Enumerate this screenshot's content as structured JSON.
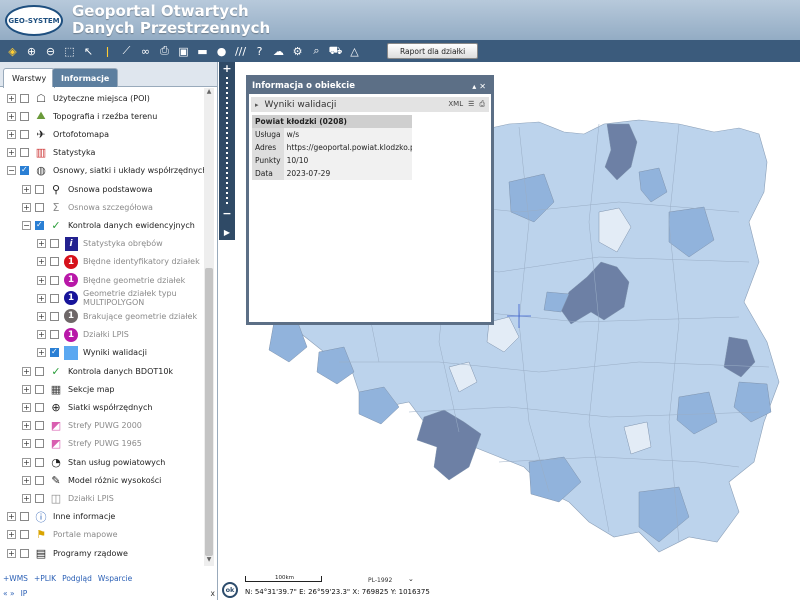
{
  "header": {
    "logo_text": "GEO-SYSTEM",
    "title_line1": "Geoportal Otwartych",
    "title_line2": "Danych Przestrzennych"
  },
  "toolbar": {
    "icons": [
      "layers-icon",
      "zoom-in-icon",
      "zoom-out-icon",
      "full-extent-icon",
      "pointer-icon",
      "identify-icon",
      "measure-icon",
      "link-icon",
      "print-icon",
      "export-icon",
      "draw-line-icon",
      "comment-icon",
      "hatch-icon",
      "help-icon",
      "cloud-icon",
      "settings-icon",
      "search-icon",
      "cart-icon",
      "shapes-icon"
    ],
    "report_button": "Raport dla działki"
  },
  "left_panel": {
    "tabs": [
      {
        "label": "Warstwy",
        "active": true
      },
      {
        "label": "Informacje",
        "active": false
      }
    ],
    "layers": [
      {
        "label": "Użyteczne miejsca (POI)",
        "icon": "poi-icon",
        "checked": false,
        "level": 0
      },
      {
        "label": "Topografia i rzeźba terenu",
        "icon": "topography-icon",
        "checked": false,
        "level": 0
      },
      {
        "label": "Ortofotomapa",
        "icon": "satellite-icon",
        "checked": false,
        "level": 0
      },
      {
        "label": "Statystyka",
        "icon": "chart-icon",
        "checked": false,
        "level": 0
      },
      {
        "label": "Osnowy, siatki i układy współrzędnych",
        "icon": "globe-icon",
        "checked": true,
        "level": 0
      },
      {
        "label": "Osnowa podstawowa",
        "icon": "pin-icon",
        "checked": false,
        "level": 1
      },
      {
        "label": "Osnowa szczegółowa",
        "icon": "sigma-icon",
        "checked": false,
        "level": 1,
        "dim": true
      },
      {
        "label": "Kontrola danych ewidencyjnych",
        "icon": "check-circle-icon",
        "checked": true,
        "level": 1
      },
      {
        "label": "Statystyka obrębów",
        "icon": "info-box-icon",
        "checked": false,
        "level": 2,
        "dim": true
      },
      {
        "label": "Błędne identyfikatory działek",
        "icon": "badge-red-1",
        "checked": false,
        "level": 2,
        "dim": true
      },
      {
        "label": "Błędne geometrie działek",
        "icon": "badge-magenta-1",
        "checked": false,
        "level": 2,
        "dim": true
      },
      {
        "label": "Geometrie działek typu MULTIPOLYGON",
        "icon": "badge-navy-1",
        "checked": false,
        "level": 2,
        "dim": true
      },
      {
        "label": "Brakujące geometrie działek",
        "icon": "badge-gray-1",
        "checked": false,
        "level": 2,
        "dim": true
      },
      {
        "label": "Działki LPIS",
        "icon": "badge-magenta-1",
        "checked": false,
        "level": 2,
        "dim": true
      },
      {
        "label": "Wyniki walidacji",
        "icon": "blue-square-icon",
        "checked": true,
        "level": 2
      },
      {
        "label": "Kontrola danych BDOT10k",
        "icon": "check-circle-icon",
        "checked": false,
        "level": 1
      },
      {
        "label": "Sekcje map",
        "icon": "grid-icon",
        "checked": false,
        "level": 1
      },
      {
        "label": "Siatki współrzędnych",
        "icon": "globe-grid-icon",
        "checked": false,
        "level": 1
      },
      {
        "label": "Strefy PUWG 2000",
        "icon": "zones-icon",
        "checked": false,
        "level": 1,
        "dim": true
      },
      {
        "label": "Strefy PUWG 1965",
        "icon": "zones-icon",
        "checked": false,
        "level": 1,
        "dim": true
      },
      {
        "label": "Stan usług powiatowych",
        "icon": "status-icon",
        "checked": false,
        "level": 1
      },
      {
        "label": "Model różnic wysokości",
        "icon": "height-model-icon",
        "checked": false,
        "level": 1
      },
      {
        "label": "Działki LPIS",
        "icon": "lpis-icon",
        "checked": false,
        "level": 1,
        "dim": true
      },
      {
        "label": "Inne informacje",
        "icon": "info-icon",
        "checked": false,
        "level": 0
      },
      {
        "label": "Portale mapowe",
        "icon": "portal-icon",
        "checked": false,
        "level": 0,
        "dim": true
      },
      {
        "label": "Programy rządowe",
        "icon": "map-icon",
        "checked": false,
        "level": 0
      }
    ],
    "links": [
      "+WMS",
      "+PLIK",
      "Podgląd",
      "Wsparcie"
    ],
    "footer": {
      "left": "«  »",
      "ip": "IP",
      "close": "x"
    }
  },
  "info_dialog": {
    "title": "Informacja o obiekcie",
    "section": "Wyniki walidacji",
    "xml_label": "XML",
    "table_header": "Powiat kłodzki (0208)",
    "rows": [
      {
        "key": "Usługa",
        "value": "w/s"
      },
      {
        "key": "Adres",
        "value": "https://geoportal.powiat.klodzko.pl/gsp"
      },
      {
        "key": "Punkty",
        "value": "10/10"
      },
      {
        "key": "Data",
        "value": "2023-07-29"
      }
    ]
  },
  "map": {
    "ok_button": "ok",
    "scale_label": "100km",
    "crs": "PL-1992",
    "coordinates": "N: 54°31'39.7\"  E: 26°59'23.3\"  X: 769825  Y: 1016375",
    "colors": {
      "light": "#bcd3ec",
      "mid": "#91b3dc",
      "dark": "#6d80a5",
      "border": "#8ca0b8"
    }
  }
}
